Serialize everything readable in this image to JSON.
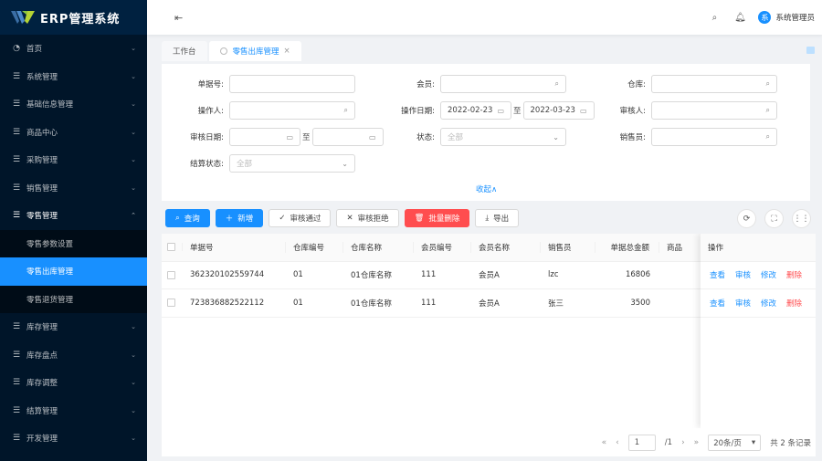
{
  "app": {
    "title": "ERP管理系统"
  },
  "sidebar": {
    "items": [
      {
        "label": "首页",
        "icon": "dashboard-icon"
      },
      {
        "label": "系统管理",
        "icon": "menu-icon"
      },
      {
        "label": "基础信息管理",
        "icon": "menu-icon"
      },
      {
        "label": "商品中心",
        "icon": "menu-icon"
      },
      {
        "label": "采购管理",
        "icon": "menu-icon"
      },
      {
        "label": "销售管理",
        "icon": "menu-icon"
      },
      {
        "label": "零售管理",
        "icon": "menu-icon",
        "expanded": true
      },
      {
        "label": "库存管理",
        "icon": "menu-icon"
      },
      {
        "label": "库存盘点",
        "icon": "menu-icon"
      },
      {
        "label": "库存调整",
        "icon": "menu-icon"
      },
      {
        "label": "结算管理",
        "icon": "menu-icon"
      },
      {
        "label": "开发管理",
        "icon": "menu-icon"
      }
    ],
    "submenu": [
      {
        "label": "零售参数设置"
      },
      {
        "label": "零售出库管理",
        "active": true
      },
      {
        "label": "零售退货管理"
      }
    ]
  },
  "header": {
    "user_avatar": "系",
    "user_name": "系统管理员"
  },
  "tabs": [
    {
      "label": "工作台"
    },
    {
      "label": "零售出库管理",
      "active": true,
      "close": "×"
    }
  ],
  "search": {
    "bill_no": {
      "label": "单据号:",
      "value": ""
    },
    "member": {
      "label": "会员:",
      "value": ""
    },
    "warehouse": {
      "label": "仓库:",
      "value": ""
    },
    "operator": {
      "label": "操作人:",
      "value": ""
    },
    "op_date": {
      "label": "操作日期:",
      "from": "2022-02-23",
      "to": "2022-03-23",
      "sep": "至"
    },
    "auditor": {
      "label": "审核人:",
      "value": ""
    },
    "audit_date": {
      "label": "审核日期:",
      "from": "",
      "to": "",
      "sep": "至"
    },
    "status": {
      "label": "状态:",
      "placeholder": "全部"
    },
    "salesman": {
      "label": "销售员:",
      "value": ""
    },
    "settle_status": {
      "label": "结算状态:",
      "placeholder": "全部"
    },
    "collapse": "收起∧"
  },
  "toolbar": {
    "query": "查询",
    "add": "新增",
    "approve": "审核通过",
    "reject": "审核拒绝",
    "batch_delete": "批量删除",
    "export": "导出"
  },
  "table": {
    "columns": [
      "单据号",
      "仓库编号",
      "仓库名称",
      "会员编号",
      "会员名称",
      "销售员",
      "单据总金额",
      "商品"
    ],
    "action_header": "操作",
    "rows": [
      {
        "bill_no": "362320102559744",
        "wh_code": "01",
        "wh_name": "01仓库名称",
        "member_code": "111",
        "member_name": "会员A",
        "salesman": "lzc",
        "total": "16806"
      },
      {
        "bill_no": "723836882522112",
        "wh_code": "01",
        "wh_name": "01仓库名称",
        "member_code": "111",
        "member_name": "会员A",
        "salesman": "张三",
        "total": "3500"
      }
    ],
    "actions": {
      "view": "查看",
      "audit": "审核",
      "edit": "修改",
      "delete": "删除"
    }
  },
  "pagination": {
    "current": "1",
    "total_pages": "/1",
    "page_size": "20条/页",
    "total_text": "共 2 条记录"
  },
  "colors": {
    "primary": "#1890ff",
    "danger": "#ff4d4f",
    "sidebar": "#001529"
  }
}
